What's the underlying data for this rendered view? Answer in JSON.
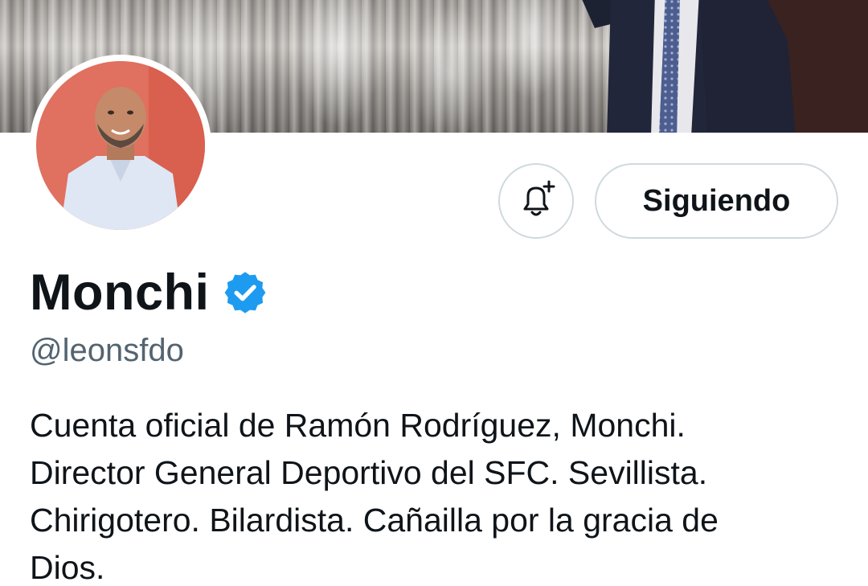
{
  "profile": {
    "display_name": "Monchi",
    "handle": "@leonsfdo",
    "verified_badge": "verified-icon",
    "bio_lines": [
      "Cuenta oficial de Ramón Rodríguez, Monchi.",
      "Director General Deportivo del SFC. Sevillista.",
      "Chirigotero. Bilardista. Cañailla por la gracia de",
      "Dios."
    ]
  },
  "actions": {
    "notification_icon": "bell-plus-icon",
    "follow_label": "Siguiendo"
  },
  "colors": {
    "verified": "#1d9bf0",
    "secondary_text": "#536471",
    "button_border": "#cfd9de",
    "avatar_background": "#e0705f"
  }
}
